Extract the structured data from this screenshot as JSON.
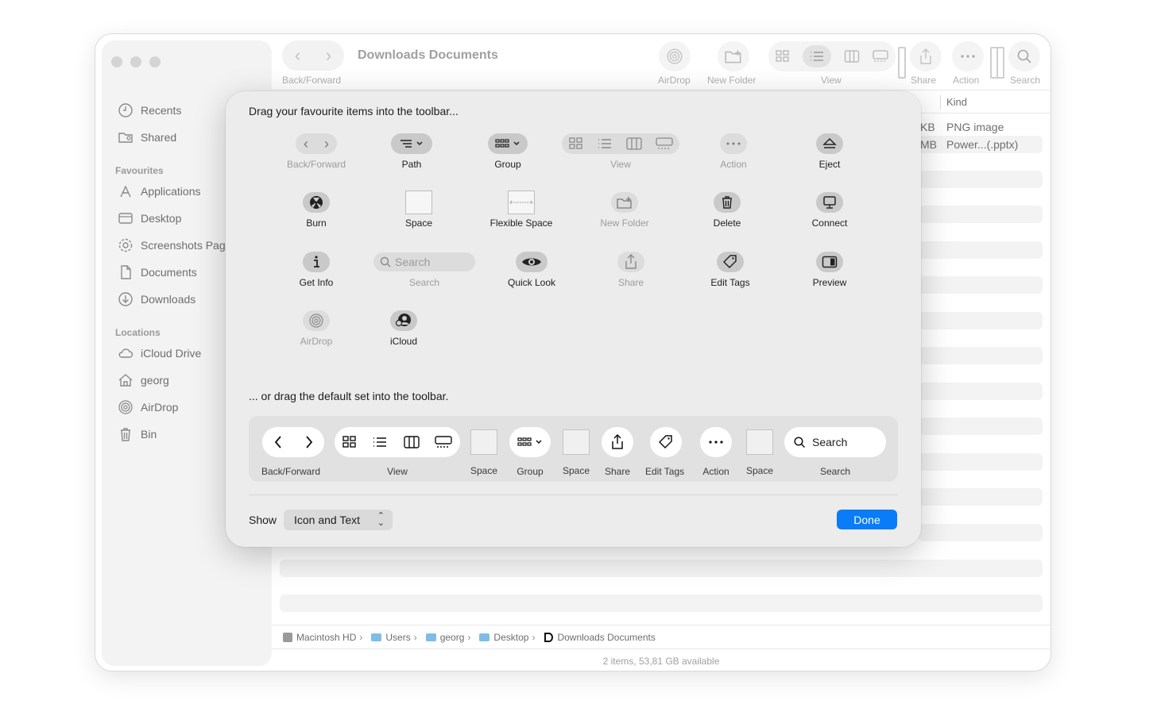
{
  "window": {
    "title": "Downloads Documents"
  },
  "sidebar": {
    "favourites_heading": "Favourites",
    "locations_heading": "Locations",
    "top_items": [
      {
        "label": "Recents",
        "icon": "clock-icon"
      },
      {
        "label": "Shared",
        "icon": "shared-folder-icon"
      }
    ],
    "favourites": [
      {
        "label": "Applications",
        "icon": "applications-icon"
      },
      {
        "label": "Desktop",
        "icon": "desktop-icon"
      },
      {
        "label": "Screenshots Pag",
        "icon": "gear-icon"
      },
      {
        "label": "Documents",
        "icon": "document-icon"
      },
      {
        "label": "Downloads",
        "icon": "download-icon"
      }
    ],
    "locations": [
      {
        "label": "iCloud Drive",
        "icon": "cloud-icon"
      },
      {
        "label": "georg",
        "icon": "home-icon"
      },
      {
        "label": "AirDrop",
        "icon": "airdrop-icon"
      },
      {
        "label": "Bin",
        "icon": "trash-icon"
      }
    ]
  },
  "toolbar": {
    "back_forward_label": "Back/Forward",
    "airdrop_label": "AirDrop",
    "new_folder_label": "New Folder",
    "view_label": "View",
    "share_label": "Share",
    "action_label": "Action",
    "search_label": "Search"
  },
  "file_list": {
    "kind_header": "Kind",
    "rows": [
      {
        "size_fragment": "KB",
        "kind": "PNG image"
      },
      {
        "size_fragment": "MB",
        "kind": "Power...(.pptx)"
      }
    ]
  },
  "path_bar": {
    "crumbs": [
      "Macintosh HD",
      "Users",
      "georg",
      "Desktop",
      "Downloads Documents"
    ]
  },
  "status_bar": {
    "text": "2 items, 53,81 GB available"
  },
  "customize_sheet": {
    "title": "Drag your favourite items into the toolbar...",
    "palette": {
      "back_forward": "Back/Forward",
      "path": "Path",
      "group": "Group",
      "view": "View",
      "action": "Action",
      "eject": "Eject",
      "burn": "Burn",
      "space": "Space",
      "flexible_space": "Flexible Space",
      "new_folder": "New Folder",
      "delete": "Delete",
      "connect": "Connect",
      "get_info": "Get Info",
      "search_field": "Search",
      "search": "Search",
      "quick_look": "Quick Look",
      "share": "Share",
      "edit_tags": "Edit Tags",
      "preview": "Preview",
      "airdrop": "AirDrop",
      "icloud": "iCloud"
    },
    "default_set_title": "... or drag the default set into the toolbar.",
    "default_set": {
      "back_forward": "Back/Forward",
      "view": "View",
      "space1": "Space",
      "group": "Group",
      "space2": "Space",
      "share": "Share",
      "edit_tags": "Edit Tags",
      "action": "Action",
      "space3": "Space",
      "search_field": "Search",
      "search": "Search"
    },
    "show_label": "Show",
    "show_value": "Icon and Text",
    "done_label": "Done",
    "accent_color": "#0a7cf7"
  }
}
